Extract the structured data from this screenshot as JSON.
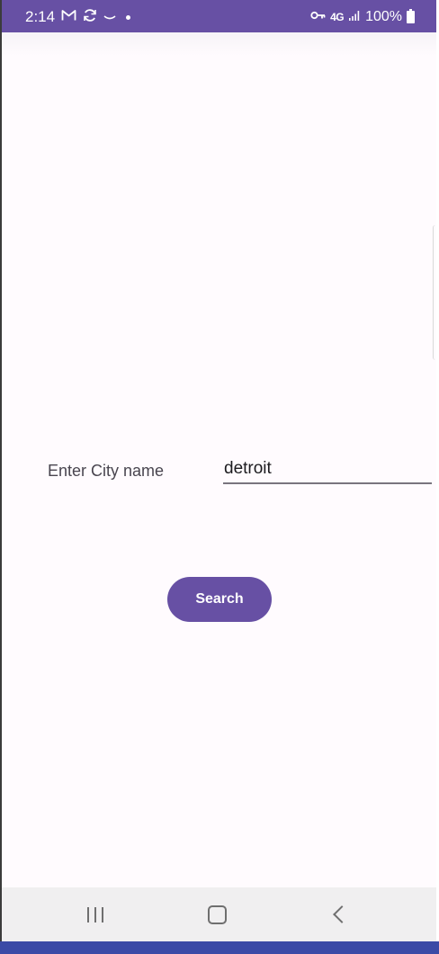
{
  "status_bar": {
    "time": "2:14",
    "battery_percent": "100%",
    "network": "4G",
    "left_icons": [
      "gmail-icon",
      "sync-icon",
      "tv-icon",
      "dot-icon"
    ],
    "right_icons": [
      "vpn-key-icon",
      "lte-icon",
      "signal-icon",
      "battery-icon"
    ]
  },
  "form": {
    "city_label": "Enter City name",
    "city_value": "detroit"
  },
  "actions": {
    "search_label": "Search"
  },
  "nav_bar": {
    "icons": [
      "recents-icon",
      "home-icon",
      "back-icon"
    ]
  },
  "colors": {
    "primary": "#6750a4",
    "background": "#fffbfe",
    "nav_background": "#f0eff0"
  }
}
